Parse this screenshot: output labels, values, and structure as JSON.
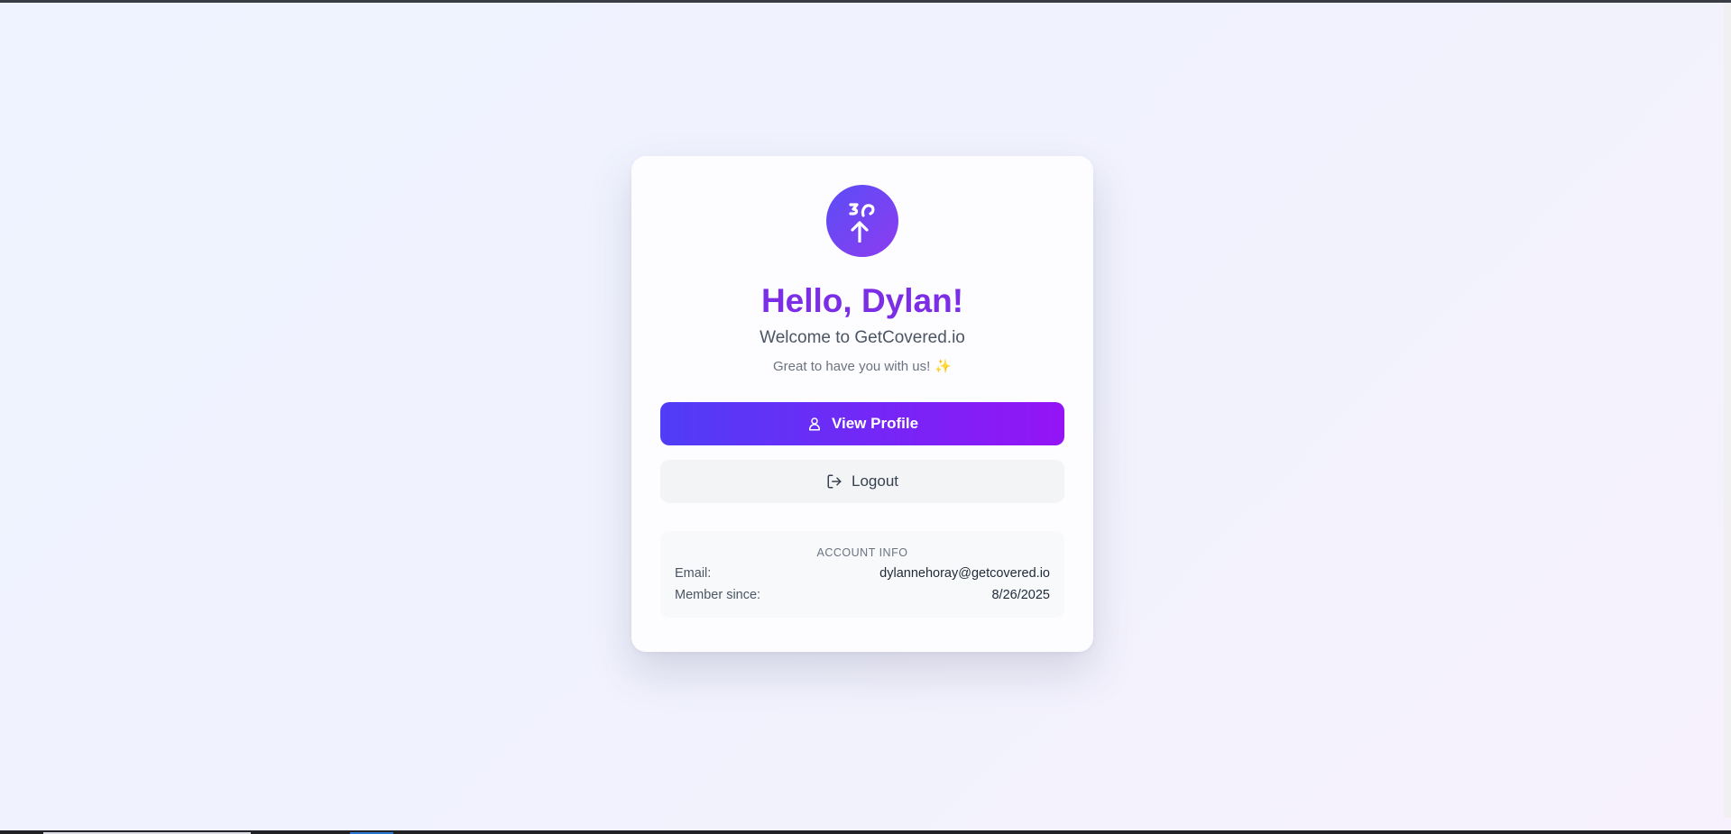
{
  "greeting": "Hello, Dylan!",
  "welcome": "Welcome to GetCovered.io",
  "tagline": "Great to have you with us!",
  "tagline_emoji": "✨",
  "buttons": {
    "view_profile": "View Profile",
    "logout": "Logout"
  },
  "account_info": {
    "title": "ACCOUNT INFO",
    "email_label": "Email:",
    "email_value": "dylannehoray@getcovered.io",
    "member_since_label": "Member since:",
    "member_since_value": "8/26/2025"
  },
  "icons": {
    "logo": "brand-logo-icon",
    "view_profile": "user-icon",
    "logout": "logout-icon"
  },
  "colors": {
    "accent": "#7b2ee6",
    "primary_gradient_start": "#4f3df7",
    "primary_gradient_end": "#9414f6"
  }
}
